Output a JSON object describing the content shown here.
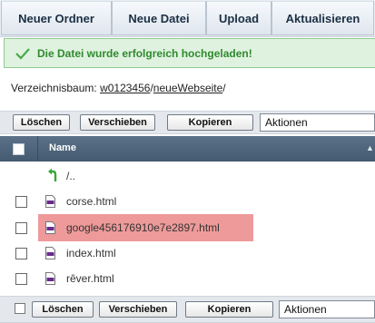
{
  "toolbar": {
    "new_folder": "Neuer Ordner",
    "new_file": "Neue Datei",
    "upload": "Upload",
    "refresh": "Aktualisieren"
  },
  "alert": {
    "message": "Die Datei wurde erfolgreich hochgeladen!",
    "icon": "check-icon",
    "color": "#2f8a2f"
  },
  "breadcrumb": {
    "label": "Verzeichnisbaum:",
    "root": "w0123456",
    "sep1": "/",
    "folder": "neueWebseite",
    "sep2": "/"
  },
  "actions_top": {
    "delete": "Löschen",
    "move": "Verschieben",
    "copy": "Kopieren",
    "select_value": "Aktionen"
  },
  "actions_bottom": {
    "delete": "Löschen",
    "move": "Verschieben",
    "copy": "Kopieren",
    "select_value": "Aktionen"
  },
  "table": {
    "column_name": "Name",
    "sort_indicator": "▲",
    "parent_dir": "/..",
    "files": [
      {
        "name": "corse.html"
      },
      {
        "name": "google456176910e7e2897.html"
      },
      {
        "name": "index.html"
      },
      {
        "name": "rêver.html"
      }
    ],
    "highlight_color": "#ee9a9a"
  }
}
